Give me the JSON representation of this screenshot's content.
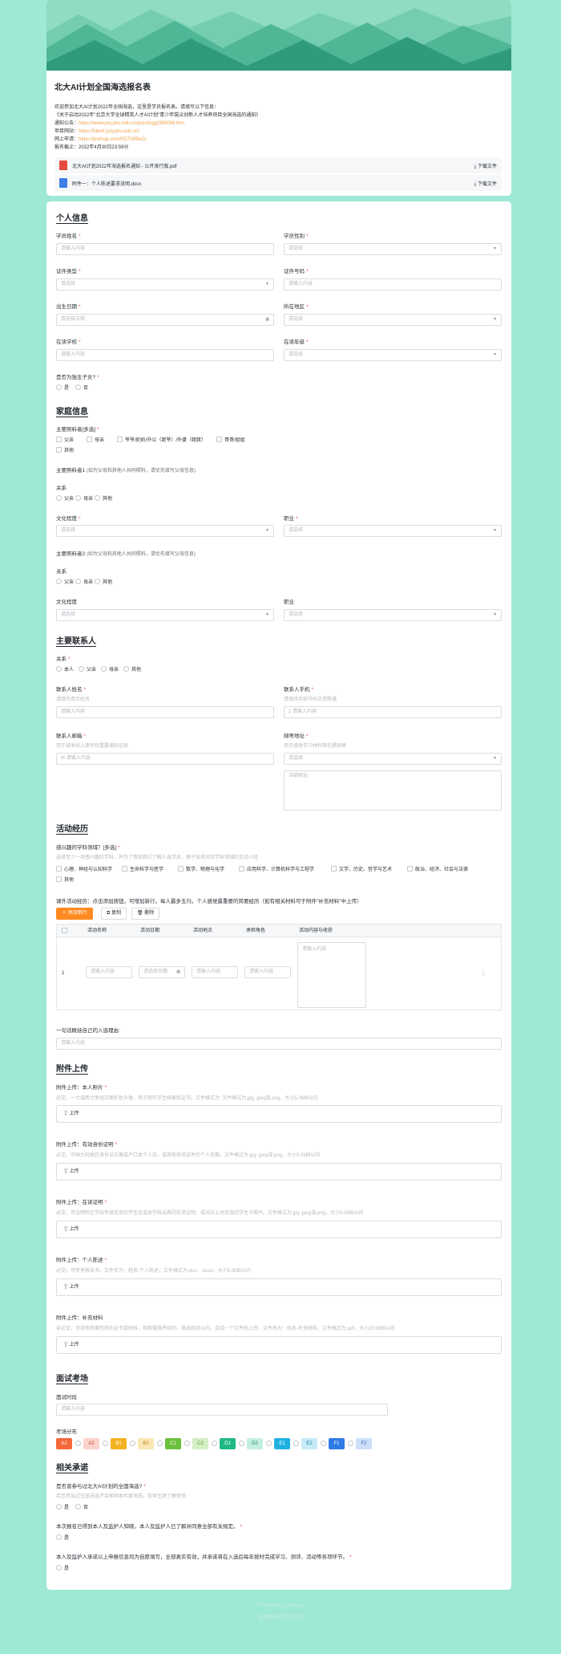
{
  "header": {
    "title": "北大AI计划全国海选报名表",
    "intro_lines": [
      "欢迎参加北大AI计划2022年全国海选，这里是学员报名表。请填写以下信息：",
      "《关于启动2022年\"北京大学全球精英人才AI计划\"青少年拔尖创新人才培养项目全国海选的通知》"
    ],
    "info": [
      {
        "label": "通知公告：",
        "value": "https://www.psy.pku.edu.cn/jwzx/tzgg/385066.htm"
      },
      {
        "label": "项目网站：",
        "value": "https://talent.psy.pku.edu.cn/"
      },
      {
        "label": "网上申请：",
        "value": "https://jinshuju.com/f/D7V8Be2s"
      },
      {
        "label": "报名截止：",
        "value": "2022年4月30日23:59分"
      }
    ],
    "files": [
      {
        "name": "北大AI计划2022年海选报名通知 - 公开发行版.pdf",
        "action": "下载文件",
        "color": "#e64a3f"
      },
      {
        "name": "附件一：个人陈述要求说明.docx",
        "action": "下载文件",
        "color": "#3f7fe6"
      }
    ]
  },
  "common": {
    "placeholder_text": "请输入内容",
    "placeholder_select": "请选择",
    "placeholder_date": "请选择日期",
    "required": "*",
    "upload": "上传"
  },
  "personal": {
    "title": "个人信息",
    "name": "学员姓名",
    "gender": "学员性别",
    "id_type": "证件类型",
    "id_number": "证件号码",
    "birth": "出生日期",
    "region": "所在地区",
    "school": "在读学校",
    "grade": "在读年级",
    "only_child": "是否为独生子女?",
    "yes": "是",
    "no": "否"
  },
  "family": {
    "title": "家庭信息",
    "guardian": "主要照料者[多选]",
    "guardian_opts": [
      "父亲",
      "母亲",
      "爷爷/奶奶/外公（姥爷）/外婆（姥姥）",
      "哥哥/姐姐",
      "其他"
    ],
    "g1": "主要照料者1",
    "g2": "主要照料者2",
    "g_hint": "(如为父母和其他人共同照料，请优先填写父母信息)",
    "relation": "关系",
    "relation_opts": [
      "父亲",
      "母亲",
      "其他"
    ],
    "education": "文化程度",
    "job": "职业"
  },
  "contact": {
    "title": "主要联系人",
    "relation": "关系",
    "relation_opts": [
      "本人",
      "父亲",
      "母亲",
      "其他"
    ],
    "name": "联系人姓名",
    "name_hint": "请填写真实姓名",
    "phone": "联系人手机",
    "phone_hint": "请保持手机号码正常畅通",
    "email": "联系人邮箱",
    "email_hint": "用于接收线上测评和重要通知信息",
    "address": "邮寄地址",
    "address_hint": "用于接收学习材料等包裹邮寄",
    "address_detail": "详细地址"
  },
  "activity": {
    "title": "活动经历",
    "interest": "感兴趣的学科领域？[多选]",
    "interest_hint": "选择至少一项感兴趣的学科，并为了帮助我们了解人选学员，便于安排对应学科领域的交流小组",
    "interest_opts": [
      "心理、神经与认知科学",
      "生命科学与医学",
      "数学、物理与化学",
      "应用科学、计算机科学与工程学",
      "文学、历史、哲学与艺术",
      "政治、经济、社会与法律",
      "其他"
    ],
    "exp_label": "课外活动经历：点击添加按钮，可增加新行，每人最多五行。个人感觉最重要的简要经历（如有相关材料可于附件\"补充材料\"中上传）",
    "add": "添加新行",
    "copy": "复制",
    "delete": "删除",
    "columns": [
      "活动名称",
      "活动日期",
      "活动地点",
      "承担角色",
      "活动内容与收获"
    ],
    "row_no": "1",
    "motto": "一句话概括自己的入选理由:"
  },
  "uploads": {
    "title": "附件上传",
    "items": [
      {
        "label": "附件上传：本人照片",
        "req": true,
        "hint": "必交。一寸或两寸免冠正面彩色头像，用于制作学生档案和证书。文件格式为: 文件格式为.jpg .jpeg或.png，大小5.0MB以内"
      },
      {
        "label": "附件上传：有效身份证明",
        "req": true,
        "hint": "必交。中国大陆地区身份证正面或户口本个人页，或其他有效证件的个人页面。文件格式为.jpg .jpeg或.png，大小5.0MB以内"
      },
      {
        "label": "附件上传：在读证明",
        "req": true,
        "hint": "必交。可证明所在学校年级信息的学生证或由学校出具的在读证明，或对应上述信息的学生卡照片。文件格式为.jpg .jpeg或.png，大小5.0MB以内"
      },
      {
        "label": "附件上传：个人陈述",
        "req": true,
        "hint": "必交。可参考报告书、文件名为：姓名-个人陈述，文件格式为.doc、.docx，大小5.0MB以内"
      },
      {
        "label": "附件上传：补充材料",
        "req": false,
        "hint": "非必交。可说明参赛所获的证书或材料，档案暨排序排列。限选四项以内，合成一个文件后上传。文件名为：姓名-补充材料，文件格式为.pdf，大小20.0MB以内"
      }
    ]
  },
  "interview": {
    "title": "面试考场",
    "slot": "面试时段",
    "seats_label": "考场分布",
    "seats": [
      {
        "id": "A1",
        "bg": "#f4683a",
        "fg": "#ffffff"
      },
      {
        "id": "A2",
        "bg": "#fbd3cb",
        "fg": "#c44a2c"
      },
      {
        "id": "B1",
        "bg": "#f3b320",
        "fg": "#ffffff"
      },
      {
        "id": "B2",
        "bg": "#fbe7b5",
        "fg": "#b9841a"
      },
      {
        "id": "C1",
        "bg": "#6cc13c",
        "fg": "#ffffff"
      },
      {
        "id": "C2",
        "bg": "#d4efc3",
        "fg": "#4f9a2c"
      },
      {
        "id": "D1",
        "bg": "#20b986",
        "fg": "#ffffff"
      },
      {
        "id": "D2",
        "bg": "#c4efe0",
        "fg": "#1e8f69"
      },
      {
        "id": "E1",
        "bg": "#1fb2e0",
        "fg": "#ffffff"
      },
      {
        "id": "E2",
        "bg": "#c7ebf8",
        "fg": "#1b86ab"
      },
      {
        "id": "F1",
        "bg": "#2f7be6",
        "fg": "#ffffff"
      },
      {
        "id": "F2",
        "bg": "#cddff8",
        "fg": "#2f64b8"
      }
    ]
  },
  "commit": {
    "title": "相关承诺",
    "q1": "是否曾参与过北大AI计划的全国海选?",
    "q1_hint": "若您参加过往届海选不会影响本年度海选，仅供主题了解使用",
    "q2": "本次报名已得到本人及监护人知晓，本人及监护人已了解并同意全部有关规定。",
    "q3": "本人及监护人承诺以上申报信息均为自愿填写，全部真实有效，并承诺将在入选后每年按时完成学习、测评、活动等各项环节。",
    "yes": "是",
    "no": "否"
  },
  "footer": {
    "line1": "Powered by Jinshuju",
    "line2": "金数据表单 隐私条款"
  }
}
